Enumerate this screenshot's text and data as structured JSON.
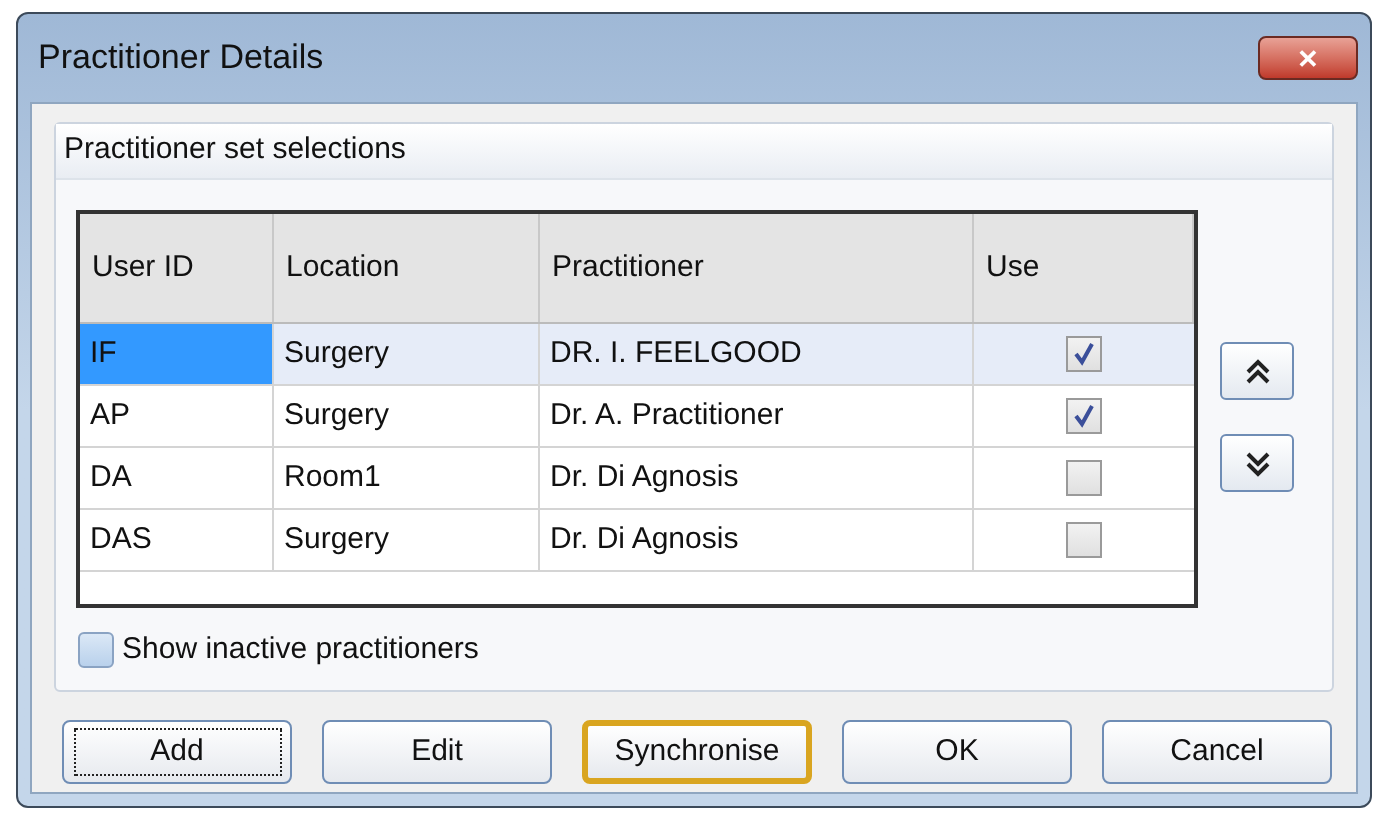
{
  "window": {
    "title": "Practitioner Details",
    "close_icon": "✕"
  },
  "group": {
    "title": "Practitioner set selections"
  },
  "table": {
    "columns": [
      "User ID",
      "Location",
      "Practitioner",
      "Use"
    ],
    "rows": [
      {
        "user_id": "IF",
        "location": "Surgery",
        "practitioner": "DR. I. FEELGOOD",
        "use": true,
        "selected": true
      },
      {
        "user_id": "AP",
        "location": "Surgery",
        "practitioner": "Dr. A. Practitioner",
        "use": true,
        "selected": false
      },
      {
        "user_id": "DA",
        "location": "Room1",
        "practitioner": "Dr. Di Agnosis",
        "use": false,
        "selected": false
      },
      {
        "user_id": "DAS",
        "location": "Surgery",
        "practitioner": "Dr. Di Agnosis",
        "use": false,
        "selected": false
      }
    ]
  },
  "show_inactive": {
    "label": "Show inactive practitioners",
    "checked": false
  },
  "buttons": [
    {
      "label": "Add",
      "focused": true,
      "default": false
    },
    {
      "label": "Edit",
      "focused": false,
      "default": false
    },
    {
      "label": "Synchronise",
      "focused": false,
      "default": true
    },
    {
      "label": "OK",
      "focused": false,
      "default": false
    },
    {
      "label": "Cancel",
      "focused": false,
      "default": false
    }
  ]
}
